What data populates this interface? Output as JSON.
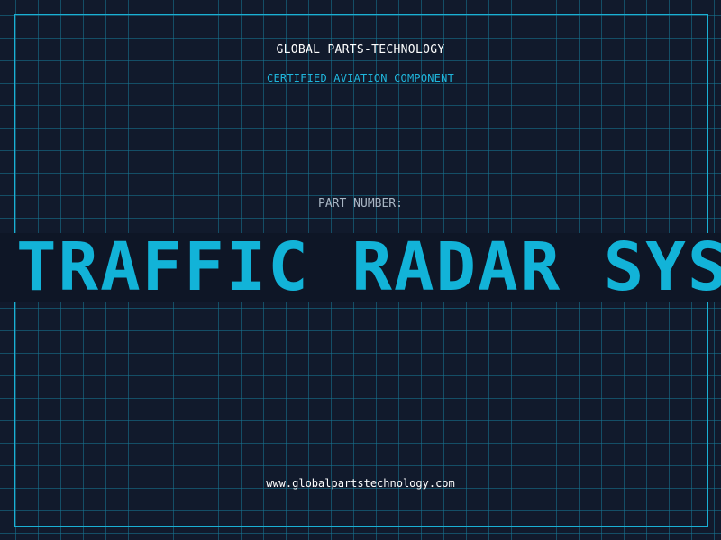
{
  "header": {
    "company": "GLOBAL PARTS-TECHNOLOGY",
    "tagline": "CERTIFIED AVIATION COMPONENT"
  },
  "part": {
    "label": "PART NUMBER:",
    "name": "TRAFFIC RADAR SYST"
  },
  "footer": {
    "website": "www.globalpartstechnology.com"
  },
  "colors": {
    "background": "#111a2c",
    "accent": "#12b3d8",
    "grid": "#16788f"
  }
}
